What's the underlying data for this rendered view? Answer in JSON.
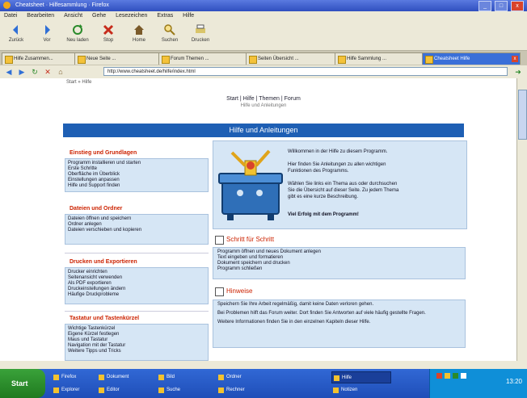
{
  "window": {
    "title": "Cheatsheet · Hilfesammlung · Firefox",
    "buttons": [
      "_",
      "□",
      "x"
    ]
  },
  "menu": [
    "Datei",
    "Bearbeiten",
    "Ansicht",
    "Gehe",
    "Lesezeichen",
    "Extras",
    "Hilfe"
  ],
  "toolbar": [
    "Zurück",
    "Vor",
    "Neu laden",
    "Stop",
    "Home",
    "Suchen",
    "Drucken"
  ],
  "tabs": [
    {
      "label": "Hilfe Zusammen..."
    },
    {
      "label": "Neue Seite ..."
    },
    {
      "label": "Forum Themen ..."
    },
    {
      "label": "Seiten Übersicht ..."
    },
    {
      "label": "Hilfe Sammlung ..."
    },
    {
      "label": "Cheatsheet Hilfe",
      "active": true
    }
  ],
  "address": {
    "url": "http://www.cheatsheet.de/hilfe/index.html"
  },
  "page": {
    "breadcrumb": "Start » Hilfe",
    "header_links": "Start | Hilfe | Themen | Forum",
    "header_sub": "Hilfe und Anleitungen",
    "banner": "Hilfe und Anleitungen",
    "left_sections": [
      {
        "title": "Einstieg und Grundlagen",
        "lines": [
          "Programm installieren und starten",
          "Erste Schritte",
          "Oberfläche im Überblick",
          "Einstellungen anpassen",
          "Hilfe und Support finden"
        ]
      },
      {
        "title": "Dateien und Ordner",
        "lines": [
          "Dateien öffnen und speichern",
          "Ordner anlegen",
          "Dateien verschieben und kopieren"
        ]
      },
      {
        "title": "Drucken und Exportieren",
        "lines": [
          "Drucker einrichten",
          "Seitenansicht verwenden",
          "Als PDF exportieren",
          "Druckeinstellungen ändern",
          "Häufige Druckprobleme"
        ]
      },
      {
        "title": "Tastatur und Tastenkürzel",
        "lines": [
          "Wichtige Tastenkürzel",
          "Eigene Kürzel festlegen",
          "Maus und Tastatur",
          "Navigation mit der Tastatur",
          "Weitere Tipps und Tricks"
        ]
      }
    ],
    "intro": [
      "Willkommen in der Hilfe zu diesem Programm.",
      "Hier finden Sie Anleitungen zu allen wichtigen",
      "Funktionen des Programms.",
      "Wählen Sie links ein Thema aus oder durchsuchen",
      "Sie die Übersicht auf dieser Seite. Zu jedem Thema",
      "gibt es eine kurze Beschreibung.",
      "Viel Erfolg mit dem Programm!"
    ],
    "checklists": [
      {
        "title": "Schritt für Schritt",
        "lines": [
          "Programm öffnen und neues Dokument anlegen",
          "Text eingeben und formatieren",
          "Dokument speichern und drucken",
          "Programm schließen"
        ]
      },
      {
        "title": "Hinweise",
        "lines": [
          "Speichern Sie Ihre Arbeit regelmäßig, damit keine Daten verloren gehen.",
          "Bei Problemen hilft das Forum weiter. Dort finden Sie Antworten auf viele häufig gestellte Fragen.",
          "Weitere Informationen finden Sie in den einzelnen Kapiteln dieser Hilfe."
        ]
      }
    ]
  },
  "taskbar": {
    "start": "Start",
    "items": [
      {
        "label": "Firefox"
      },
      {
        "label": "Explorer"
      },
      {
        "label": "Dokument"
      },
      {
        "label": "Editor"
      },
      {
        "label": "Bild"
      },
      {
        "label": "Hilfe",
        "active": true
      },
      {
        "label": "Ordner"
      },
      {
        "label": "Suche"
      },
      {
        "label": "Rechner"
      },
      {
        "label": "Notizen"
      }
    ],
    "clock": "13:20"
  },
  "colors": {
    "banner": "#1e5fb4",
    "section_title": "#cc2200",
    "box_fill": "#d6e6f5",
    "taskbar": "#2a5fcc",
    "start_button": "#2e8b2e"
  }
}
